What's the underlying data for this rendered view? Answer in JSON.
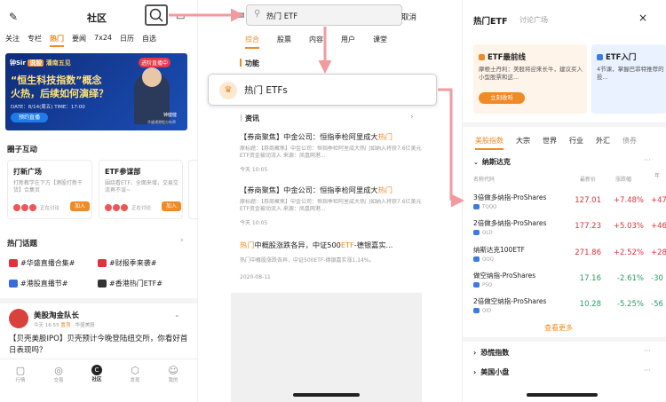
{
  "p1": {
    "title": "社区",
    "tabs": [
      "关注",
      "专栏",
      "热门",
      "要闻",
      "7x24",
      "日历",
      "自选"
    ],
    "active_tab": "热门",
    "banner": {
      "brand": "钟Sir",
      "brand_tag": "说股",
      "subtitle": "潘南五见",
      "badge": "进阶直播中",
      "line1": "“恒生科技指数”概念",
      "line2": "火热，后续如何演绎？",
      "date": "DATE：8/14(周五) TIME：17:00",
      "button": "预约直播",
      "person": "钟健健",
      "person_title": "华盛通港股分析师"
    },
    "section_circle": "圈子互动",
    "circle_cards": [
      {
        "title": "打新广场",
        "desc": "打新教学在下方【港股打新干货】合集页",
        "status": "正在讨论",
        "btn": "加入"
      },
      {
        "title": "ETF参谋部",
        "desc": "围绕看ETF、全面来增，交易交流再不误~",
        "status": "正在讨论",
        "btn": "加入"
      },
      {
        "title": "",
        "desc": "",
        "status": "",
        "btn": ""
      }
    ],
    "section_hot": "热门话题",
    "topics": [
      "#华盛直播合集#",
      "#财报季来袭#",
      "#港股直播节#",
      "#香港热门ETF#"
    ],
    "post": {
      "author": "美股淘金队长",
      "time": "今天 16:55",
      "tag1": "置顶",
      "tag2": "华盛美股",
      "text": "【贝壳美股IPO】贝壳预计今晚登陆纽交所，你看好首日表现吗？"
    },
    "nav": [
      "行情",
      "交易",
      "社区",
      "发现",
      "我的"
    ],
    "active_nav": "社区"
  },
  "p2": {
    "search_placeholder": "热门 ETF",
    "cancel": "取消",
    "tabs": [
      "综合",
      "股票",
      "内容",
      "用户",
      "课堂"
    ],
    "active_tab": "综合",
    "section_func": "功能",
    "func_item": "热门 ETFs",
    "section_news": "资讯",
    "news": [
      {
        "title_a": "【券商聚焦】中金公司：恒指季检阿里成大",
        "title_b": "热门",
        "source": "原标题：【券商聚焦】中金公司：恒指季检阿里成大热门如纳入将获7.6亿美元ETF资金被动流入 来源：凤凰网港...",
        "time": "今天 10:05"
      },
      {
        "title_a": "【券商聚焦】中金公司：恒指季检阿里成大",
        "title_b": "热门",
        "source": "原标题：【券商聚焦】中金公司：恒指季检阿里成大热门如纳入将获7.6亿美元ETF资金被动流入 来源：凤凰网港...",
        "time": "今天 10:05"
      },
      {
        "title_a": "热门",
        "title_b": "中概股涨跌各异，中证500",
        "title_c": "ETF",
        "title_d": "-德银嘉实...",
        "source": "热门中概股涨跌各异，中证500ETF-德银嘉实涨1.14%。",
        "time": "2020-08-11"
      }
    ]
  },
  "p3": {
    "tab_active": "热门ETF",
    "tab_other": "讨论广场",
    "card1": {
      "title": "ETF最前线",
      "desc": "摩根士丹利：美股将迎来长牛，建议买入小型股票和这...",
      "btn": "立刻收听"
    },
    "card2": {
      "title": "ETF入门",
      "desc": "4节课，掌握巴菲特推荐的投..."
    },
    "market_tabs": [
      "美股指数",
      "大宗",
      "世界",
      "行业",
      "外汇",
      "债券"
    ],
    "active_market": "美股指数",
    "group": "纳斯达克",
    "col_name": "名称代码",
    "col_price": "最新价",
    "col_change": "涨跌幅",
    "col_extra": "年",
    "rows": [
      {
        "name": "3倍做多纳指-ProShares",
        "code": "TQQQ",
        "price": "127.01",
        "chg": "+7.48%",
        "extra": "+47",
        "dir": "up"
      },
      {
        "name": "2倍做多纳指-ProShares",
        "code": "QLD",
        "price": "177.23",
        "chg": "+5.03%",
        "extra": "+46",
        "dir": "up"
      },
      {
        "name": "纳斯达克100ETF",
        "code": "QQQ",
        "price": "271.86",
        "chg": "+2.52%",
        "extra": "+28",
        "dir": "up"
      },
      {
        "name": "做空纳指-ProShares",
        "code": "PSQ",
        "price": "17.16",
        "chg": "-2.61%",
        "extra": "-30",
        "dir": "down"
      },
      {
        "name": "2倍做空纳指-ProShares",
        "code": "QID",
        "price": "10.28",
        "chg": "-5.25%",
        "extra": "-56",
        "dir": "down"
      }
    ],
    "more": "查看更多",
    "collapsed": [
      "恐慌指数",
      "美国小盘"
    ]
  },
  "colors": {
    "accent": "#f08a24",
    "up": "#e0323a",
    "down": "#2a9d5c",
    "arrow": "#f29aa0"
  }
}
